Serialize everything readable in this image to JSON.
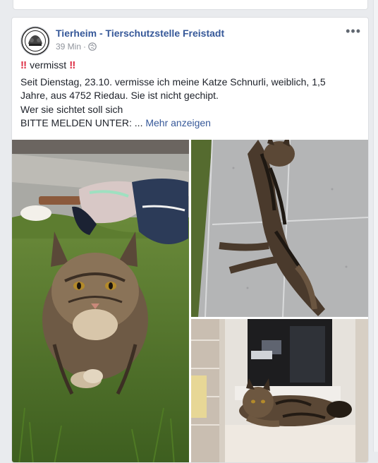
{
  "post": {
    "page_name": "Tierheim - Tierschutzstelle Freistadt",
    "time": "39 Min",
    "separator": "·",
    "more_glyph": "•••",
    "bang_left": "‼",
    "bang_right": "‼",
    "headline": "vermisst",
    "body_lines": [
      "Seit Dienstag, 23.10. vermisse ich meine Katze Schnurli, weiblich, 1,5",
      "Jahre, aus 4752 Riedau. Sie ist nicht gechipt.",
      "Wer sie sichtet soll sich",
      "BITTE MELDEN UNTER: ..."
    ],
    "see_more": "Mehr anzeigen"
  },
  "icons": {
    "avatar": "page-logo-avatar",
    "privacy": "globe-icon",
    "menu": "more-options-icon"
  },
  "photos": [
    {
      "name": "cat-in-grass-photo",
      "subject": "cat-in-grass"
    },
    {
      "name": "cat-on-pavement-photo",
      "subject": "cat-on-pavement"
    },
    {
      "name": "cat-on-windowsill-photo",
      "subject": "cat-on-windowsill"
    }
  ],
  "colors": {
    "link": "#365899",
    "meta": "#90949c",
    "text": "#1d2129",
    "background": "#e9ebee"
  }
}
